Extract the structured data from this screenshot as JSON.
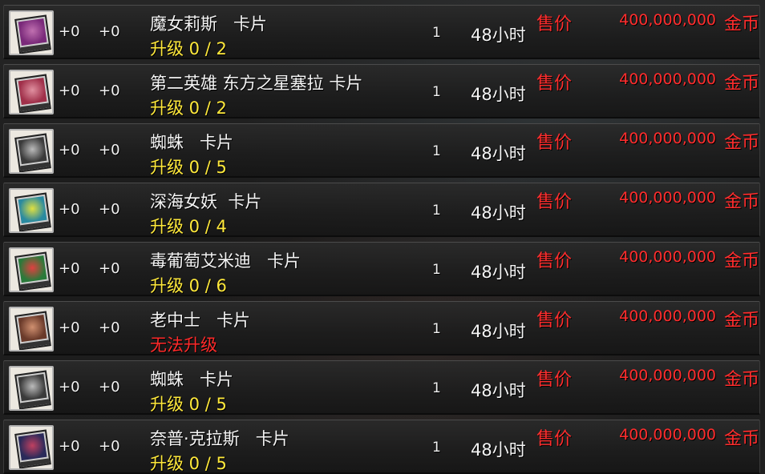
{
  "listings": [
    {
      "icon": "witch-lilith-card-icon",
      "art": [
        "#7a2a7a",
        "#c070b0"
      ],
      "enhance": "+0",
      "amplify": "+0",
      "name": "魔女莉斯   卡片",
      "upgrade": "升级 0 / 2",
      "upgradable": true,
      "quantity": "1",
      "duration": "48小时",
      "price_label": "售价",
      "price": "400,000,000",
      "currency": "金币"
    },
    {
      "icon": "star-of-east-sierra-card-icon",
      "art": [
        "#a0304a",
        "#e090a0"
      ],
      "enhance": "+0",
      "amplify": "+0",
      "name": "第二英雄 东方之星塞拉 卡片",
      "upgrade": "升级 0 / 2",
      "upgradable": true,
      "quantity": "1",
      "duration": "48小时",
      "price_label": "售价",
      "price": "400,000,000",
      "currency": "金币"
    },
    {
      "icon": "spider-card-icon",
      "art": [
        "#3a3a3a",
        "#bbbbbb"
      ],
      "enhance": "+0",
      "amplify": "+0",
      "name": "蜘蛛   卡片",
      "upgrade": "升级 0 / 5",
      "upgradable": true,
      "quantity": "1",
      "duration": "48小时",
      "price_label": "售价",
      "price": "400,000,000",
      "currency": "金币"
    },
    {
      "icon": "deep-sea-siren-card-icon",
      "art": [
        "#2a8aa0",
        "#e0e040"
      ],
      "enhance": "+0",
      "amplify": "+0",
      "name": "深海女妖  卡片",
      "upgrade": "升级 0 / 4",
      "upgradable": true,
      "quantity": "1",
      "duration": "48小时",
      "price_label": "售价",
      "price": "400,000,000",
      "currency": "金币"
    },
    {
      "icon": "poison-ivy-amidi-card-icon",
      "art": [
        "#2a7a3a",
        "#e04040"
      ],
      "enhance": "+0",
      "amplify": "+0",
      "name": "毒葡萄艾米迪   卡片",
      "upgrade": "升级 0 / 6",
      "upgradable": true,
      "quantity": "1",
      "duration": "48小时",
      "price_label": "售价",
      "price": "400,000,000",
      "currency": "金币"
    },
    {
      "icon": "old-sergeant-card-icon",
      "art": [
        "#6a3a2a",
        "#d09070"
      ],
      "enhance": "+0",
      "amplify": "+0",
      "name": "老中士   卡片",
      "upgrade": "无法升级",
      "upgradable": false,
      "quantity": "1",
      "duration": "48小时",
      "price_label": "售价",
      "price": "400,000,000",
      "currency": "金币"
    },
    {
      "icon": "spider-card-icon",
      "art": [
        "#3a3a3a",
        "#bbbbbb"
      ],
      "enhance": "+0",
      "amplify": "+0",
      "name": "蜘蛛   卡片",
      "upgrade": "升级 0 / 5",
      "upgradable": true,
      "quantity": "1",
      "duration": "48小时",
      "price_label": "售价",
      "price": "400,000,000",
      "currency": "金币"
    },
    {
      "icon": "nepp-klass-card-icon",
      "art": [
        "#2a2a5a",
        "#c04060"
      ],
      "enhance": "+0",
      "amplify": "+0",
      "name": "奈普·克拉斯   卡片",
      "upgrade": "升级 0 / 5",
      "upgradable": true,
      "quantity": "1",
      "duration": "48小时",
      "price_label": "售价",
      "price": "400,000,000",
      "currency": "金币"
    }
  ]
}
